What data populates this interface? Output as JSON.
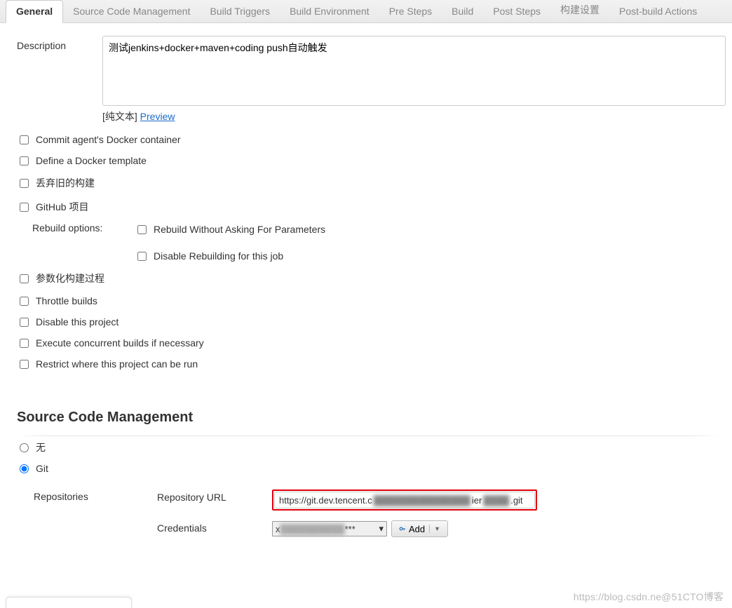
{
  "tabs": {
    "items": [
      "General",
      "Source Code Management",
      "Build Triggers",
      "Build Environment",
      "Pre Steps",
      "Build",
      "Post Steps",
      "构建设置",
      "Post-build Actions"
    ],
    "activeIndex": 0
  },
  "general": {
    "description_label": "Description",
    "description_value": "测试jenkins+docker+maven+coding push自动触发",
    "plaintext_prefix": "[纯文本] ",
    "preview_link": "Preview",
    "checkboxes": {
      "commit_agent": "Commit agent's Docker container",
      "docker_template": "Define a Docker template",
      "discard_old": "丢弃旧的构建",
      "github_proj": "GitHub 项目"
    },
    "rebuild": {
      "label": "Rebuild options:",
      "without_asking": "Rebuild Without Asking For Parameters",
      "disable": "Disable Rebuilding for this job"
    },
    "checkboxes2": {
      "parameterized": "参数化构建过程",
      "throttle": "Throttle builds",
      "disable_proj": "Disable this project",
      "concurrent": "Execute concurrent builds if necessary",
      "restrict": "Restrict where this project can be run"
    }
  },
  "scm": {
    "title": "Source Code Management",
    "radio_none": "无",
    "radio_git": "Git",
    "repositories_label": "Repositories",
    "repo_url_label": "Repository URL",
    "repo_url_prefix": "https://git.dev.tencent.c",
    "repo_url_mid": "ier",
    "repo_url_suffix": ".git",
    "credentials_label": "Credentials",
    "credentials_prefix": "x",
    "credentials_suffix": "***",
    "add_button": "Add"
  },
  "watermark": "https://blog.csdn.ne@51CTO博客"
}
